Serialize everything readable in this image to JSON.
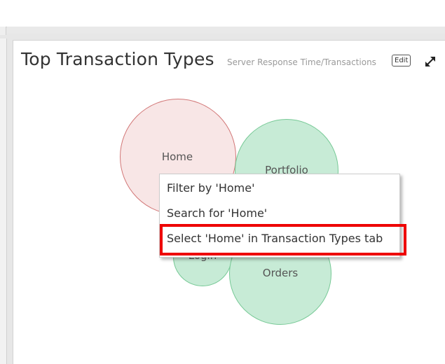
{
  "widget": {
    "title": "Top Transaction Types",
    "subtitle": "Server Response Time/Transactions",
    "edit_label": "Edit",
    "expand_icon": "expand-icon"
  },
  "bubbles": [
    {
      "label": "Home",
      "color": "#f8e6e6",
      "status": "red"
    },
    {
      "label": "Portfolio",
      "color": "#c7ebd6",
      "status": "green"
    },
    {
      "label": "Login",
      "color": "#c7ebd6",
      "status": "green"
    },
    {
      "label": "Orders",
      "color": "#c7ebd6",
      "status": "green"
    }
  ],
  "context_menu": {
    "items": [
      {
        "label": "Filter by 'Home'"
      },
      {
        "label": "Search for 'Home'"
      },
      {
        "label": "Select 'Home' in Transaction Types tab"
      }
    ]
  },
  "colors": {
    "highlight": "#ee0000",
    "red_border": "#d27777",
    "green_border": "#77c996"
  }
}
